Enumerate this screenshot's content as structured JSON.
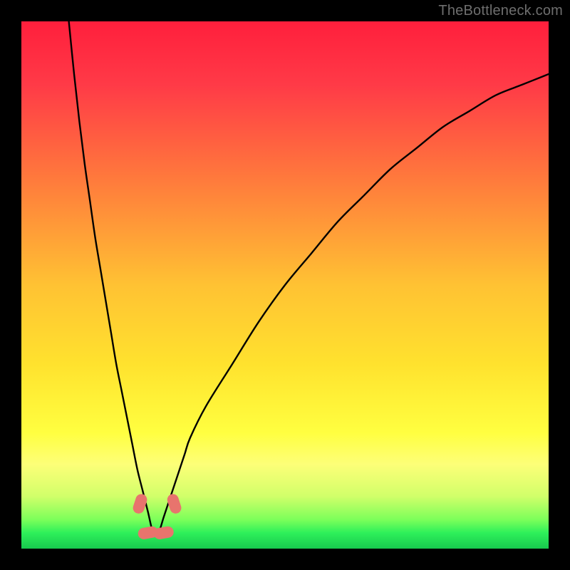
{
  "attribution": "TheBottleneck.com",
  "chart_data": {
    "type": "line",
    "title": "",
    "xlabel": "",
    "ylabel": "",
    "xlim": [
      0,
      100
    ],
    "ylim": [
      0,
      100
    ],
    "gradient_stops": [
      {
        "offset": 0.0,
        "color": "#ff1f3c"
      },
      {
        "offset": 0.12,
        "color": "#ff3a47"
      },
      {
        "offset": 0.3,
        "color": "#ff7a3c"
      },
      {
        "offset": 0.5,
        "color": "#ffc233"
      },
      {
        "offset": 0.65,
        "color": "#ffe22e"
      },
      {
        "offset": 0.78,
        "color": "#ffff40"
      },
      {
        "offset": 0.84,
        "color": "#fdff78"
      },
      {
        "offset": 0.9,
        "color": "#d2ff6a"
      },
      {
        "offset": 0.945,
        "color": "#7cff5a"
      },
      {
        "offset": 0.97,
        "color": "#2ef05a"
      },
      {
        "offset": 1.0,
        "color": "#18c94e"
      }
    ],
    "series": [
      {
        "name": "bottleneck-curve",
        "x_min_at": 25,
        "x": [
          9,
          10,
          11,
          12,
          13,
          14,
          15,
          16,
          17,
          18,
          19,
          20,
          21,
          22,
          23,
          24,
          25,
          26,
          27,
          28,
          29,
          30,
          31,
          32,
          35,
          40,
          45,
          50,
          55,
          60,
          65,
          70,
          75,
          80,
          85,
          90,
          95,
          100
        ],
        "values": [
          100,
          90,
          81,
          73,
          66,
          59,
          53,
          47,
          41,
          35,
          30,
          25,
          20,
          15,
          11,
          7,
          3,
          3,
          6,
          9,
          12,
          15,
          18,
          21,
          27,
          35,
          43,
          50,
          56,
          62,
          67,
          72,
          76,
          80,
          83,
          86,
          88,
          90
        ]
      }
    ],
    "markers": [
      {
        "name": "marker-left",
        "x": 22.5,
        "y": 8.5,
        "color": "#e8746d"
      },
      {
        "name": "marker-right",
        "x": 29.0,
        "y": 8.5,
        "color": "#e8746d"
      },
      {
        "name": "marker-min-a",
        "x": 24.0,
        "y": 3.0,
        "color": "#e8746d"
      },
      {
        "name": "marker-min-b",
        "x": 27.0,
        "y": 3.0,
        "color": "#e8746d"
      }
    ]
  }
}
